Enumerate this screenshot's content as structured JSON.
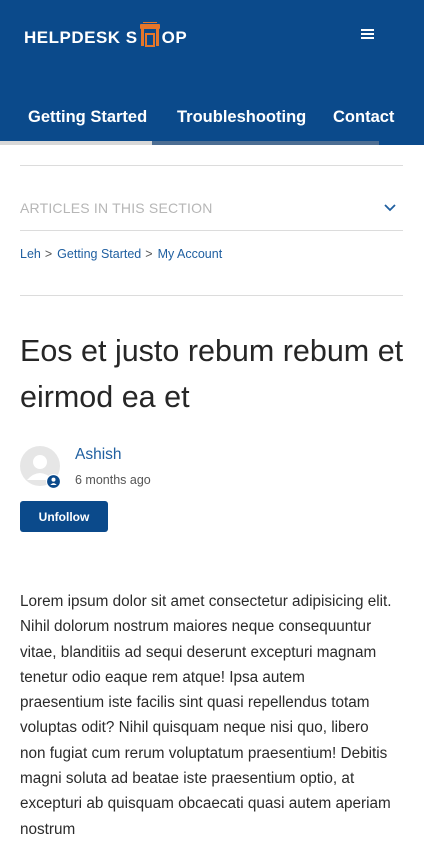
{
  "header": {
    "logo_left": "HELPDESK S",
    "logo_right": "OP",
    "logo_icon": "shop-icon",
    "menu_icon": "hamburger-menu-icon",
    "tabs": [
      {
        "label": "Getting Started"
      },
      {
        "label": "Troubleshooting"
      },
      {
        "label": "Contact"
      }
    ],
    "colors": {
      "brand": "#0b4a8b",
      "logo_accent": "#e5762b"
    }
  },
  "section_nav": {
    "label": "ARTICLES IN THIS SECTION",
    "toggle_icon": "chevron-down-icon"
  },
  "breadcrumb": {
    "items": [
      {
        "label": "Leh"
      },
      {
        "label": "Getting Started"
      },
      {
        "label": "My Account"
      }
    ],
    "separator": ">"
  },
  "article": {
    "title": "Eos et justo rebum rebum et eirmod ea et",
    "author": {
      "name": "Ashish",
      "time": "6 months ago",
      "avatar_icon": "user-avatar-icon",
      "badge_icon": "user-badge-icon"
    },
    "follow_button_label": "Unfollow",
    "body": "Lorem ipsum dolor sit amet consectetur adipisicing elit. Nihil dolorum nostrum maiores neque consequuntur vitae, blanditiis ad sequi deserunt excepturi magnam tenetur odio eaque rem atque! Ipsa autem praesentium iste facilis sint quasi repellendus totam voluptas odit? Nihil quisquam neque nisi quo, libero non fugiat cum rerum voluptatum praesentium! Debitis magni soluta ad beatae iste praesentium optio, at excepturi ab quisquam obcaecati quasi autem aperiam nostrum"
  }
}
